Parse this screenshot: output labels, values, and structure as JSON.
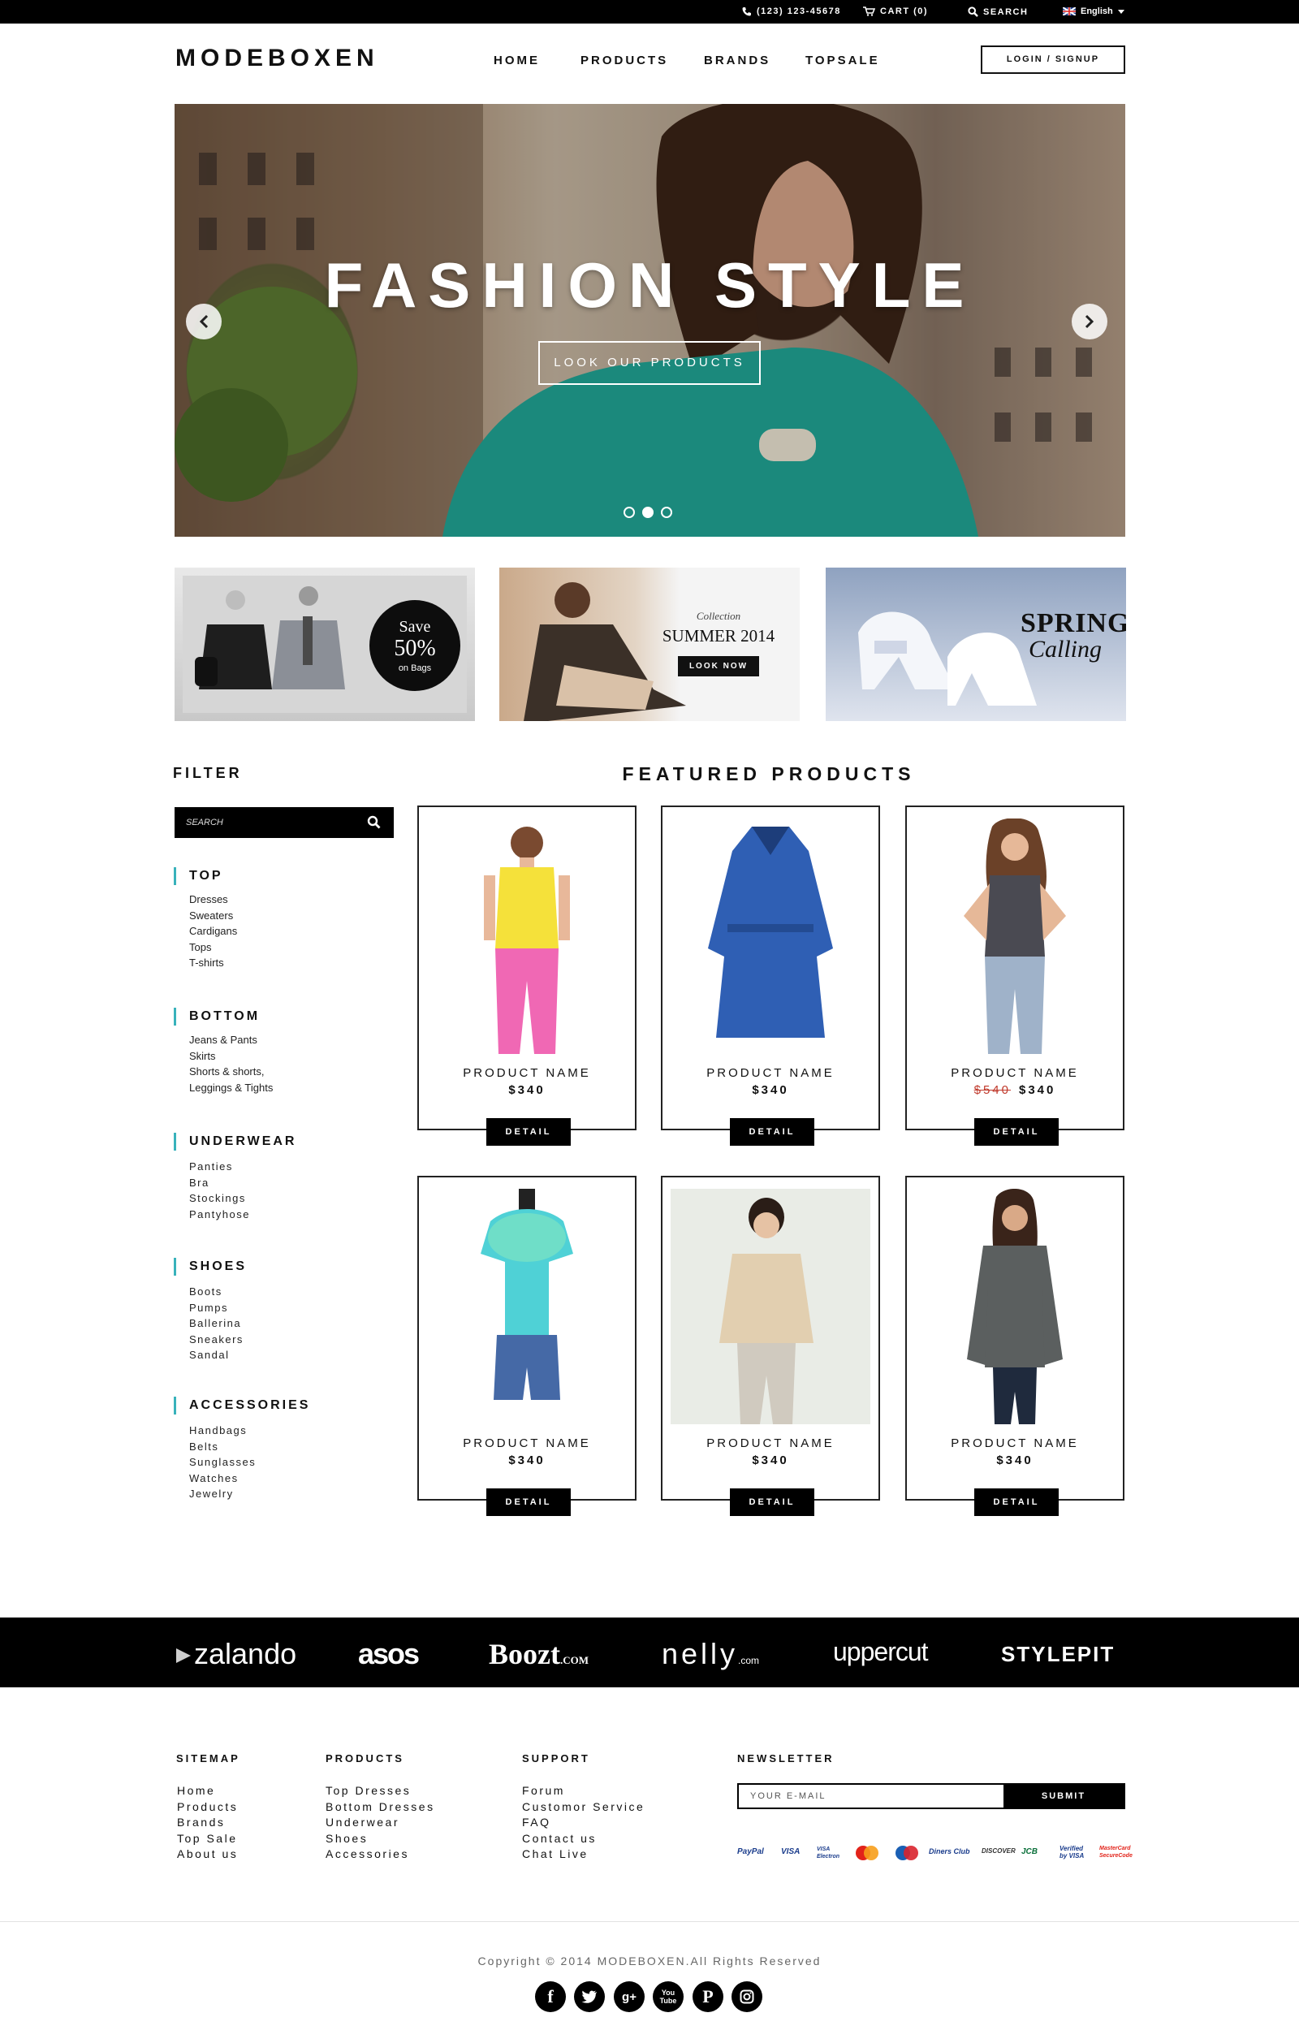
{
  "topbar": {
    "phone": "(123) 123-45678",
    "cart": "CART (0)",
    "search": "SEARCH",
    "language": "English"
  },
  "header": {
    "logo": "MODEBOXEN",
    "nav": [
      "HOME",
      "PRODUCTS",
      "BRANDS",
      "TOPSALE"
    ],
    "login": "LOGIN / SIGNUP"
  },
  "hero": {
    "title": "FASHION STYLE",
    "button": "LOOK OUR PRODUCTS",
    "slide_count": 3,
    "active_slide": 2
  },
  "banners": {
    "save": {
      "line1": "Save",
      "line2": "50%",
      "line3": "on Bags"
    },
    "summer": {
      "line1": "Collection",
      "line2": "SUMMER 2014",
      "button": "LOOK NOW"
    },
    "spring": {
      "line1": "SPRING",
      "line2": "Calling"
    }
  },
  "filter": {
    "heading": "FILTER",
    "search_placeholder": "SEARCH",
    "categories": [
      {
        "title": "TOP",
        "items": [
          "Dresses",
          "Sweaters",
          "Cardigans",
          "Tops",
          "T-shirts"
        ]
      },
      {
        "title": "BOTTOM",
        "items": [
          "Jeans & Pants",
          "Skirts",
          "Shorts & shorts,",
          "Leggings & Tights"
        ]
      },
      {
        "title": "UNDERWEAR",
        "items": [
          "Panties",
          "Bra",
          "Stockings",
          "Pantyhose"
        ]
      },
      {
        "title": "SHOES",
        "items": [
          "Boots",
          "Pumps",
          "Ballerina",
          "Sneakers",
          "Sandal"
        ]
      },
      {
        "title": "ACCESSORIES",
        "items": [
          "Handbags",
          "Belts",
          "Sunglasses",
          "Watches",
          "Jewelry"
        ]
      }
    ]
  },
  "featured": {
    "heading": "FEATURED PRODUCTS",
    "products": [
      {
        "name": "PRODUCT NAME",
        "price": "$340",
        "old_price": "",
        "button": "DETAIL"
      },
      {
        "name": "PRODUCT NAME",
        "price": "$340",
        "old_price": "",
        "button": "DETAIL"
      },
      {
        "name": "PRODUCT NAME",
        "price": "$340",
        "old_price": "$540",
        "button": "DETAIL"
      },
      {
        "name": "PRODUCT NAME",
        "price": "$340",
        "old_price": "",
        "button": "DETAIL"
      },
      {
        "name": "PRODUCT NAME",
        "price": "$340",
        "old_price": "",
        "button": "DETAIL"
      },
      {
        "name": "PRODUCT NAME",
        "price": "$340",
        "old_price": "",
        "button": "DETAIL"
      }
    ]
  },
  "brands": [
    "zalando",
    "asos",
    "Boozt",
    "nelly",
    "uppercut",
    "STYLEPIT"
  ],
  "footer": {
    "sitemap": {
      "title": "SITEMAP",
      "links": [
        "Home",
        "Products",
        "Brands",
        "Top Sale",
        "About us"
      ]
    },
    "products": {
      "title": "PRODUCTS",
      "links": [
        "Top Dresses",
        "Bottom Dresses",
        "Underwear",
        "Shoes",
        "Accessories"
      ]
    },
    "support": {
      "title": "SUPPORT",
      "links": [
        "Forum",
        "Customor Service",
        "FAQ",
        "Contact us",
        "Chat Live"
      ]
    },
    "newsletter": {
      "title": "NEWSLETTER",
      "placeholder": "YOUR E-MAIL",
      "button": "SUBMIT"
    },
    "payments": [
      "PayPal",
      "VISA",
      "VISA Electron",
      "MasterCard",
      "Maestro",
      "Diners Club",
      "DISCOVER",
      "JCB",
      "Verified by VISA",
      "MasterCard SecureCode"
    ],
    "copyright": "Copyright © 2014 MODEBOXEN.All Rights Reserved",
    "social": [
      "facebook",
      "twitter",
      "google-plus",
      "youtube",
      "pinterest",
      "instagram"
    ]
  },
  "colors": {
    "accent": "#38b2bb",
    "primary": "#000000",
    "sale": "#c0392b",
    "teal_garment": "#1d9e90"
  }
}
